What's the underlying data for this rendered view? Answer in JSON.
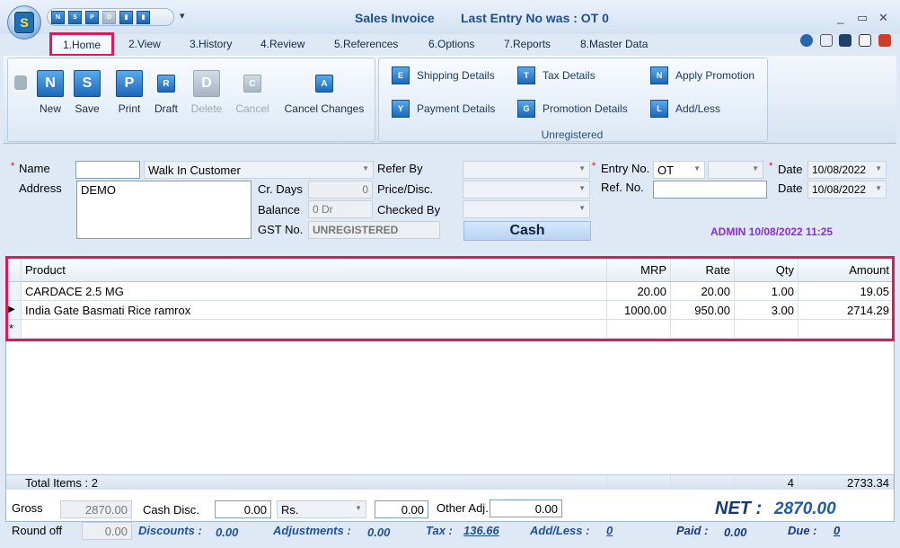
{
  "window": {
    "title": "Sales Invoice",
    "last_entry": "Last Entry No was : OT 0",
    "minimize": "_",
    "restore": "▭",
    "close": "✕",
    "qat_more": "▾",
    "orb_logo": "S"
  },
  "qat": [
    {
      "label": "N"
    },
    {
      "label": "S"
    },
    {
      "label": "P"
    },
    {
      "label": "D"
    },
    {
      "label": "▮"
    },
    {
      "label": "▮"
    }
  ],
  "tabs": [
    "1.Home",
    "2.View",
    "3.History",
    "4.Review",
    "5.References",
    "6.Options",
    "7.Reports",
    "8.Master Data"
  ],
  "ribbon": {
    "main_buttons": [
      {
        "label": "New",
        "icon": "N"
      },
      {
        "label": "Save",
        "icon": "S"
      },
      {
        "label": "Print",
        "icon": "P"
      },
      {
        "label": "Draft",
        "icon": "R"
      },
      {
        "label": "Delete",
        "icon": "D"
      },
      {
        "label": "Cancel",
        "icon": "C"
      },
      {
        "label": "Cancel Changes",
        "icon": "A"
      }
    ],
    "side_buttons": [
      {
        "label": "Shipping Details",
        "icon": "E"
      },
      {
        "label": "Tax Details",
        "icon": "T"
      },
      {
        "label": "Apply Promotion",
        "icon": "N"
      },
      {
        "label": "Payment Details",
        "icon": "Y"
      },
      {
        "label": "Promotion Details",
        "icon": "G"
      },
      {
        "label": "Add/Less",
        "icon": "L"
      }
    ],
    "group_caption": "Unregistered"
  },
  "form": {
    "name_label": "Name",
    "name_code": "",
    "name_value": "Walk In Customer",
    "address_label": "Address",
    "address_value": "DEMO",
    "cr_days_label": "Cr. Days",
    "cr_days_value": "0",
    "balance_label": "Balance",
    "balance_value": "0 Dr",
    "gst_label": "GST No.",
    "gst_value": "UNREGISTERED",
    "refer_by_label": "Refer By",
    "price_disc_label": "Price/Disc.",
    "checked_by_label": "Checked By",
    "payment_mode": "Cash",
    "entry_no_label": "Entry No.",
    "entry_no_series": "OT",
    "ref_no_label": "Ref. No.",
    "date_label": "Date",
    "date_value": "10/08/2022",
    "date2_label": "Date",
    "date2_value": "10/08/2022",
    "user_stamp": "ADMIN 10/08/2022 11:25"
  },
  "grid": {
    "columns": [
      "Product",
      "MRP",
      "Rate",
      "Qty",
      "Amount"
    ],
    "rows": [
      {
        "product": "CARDACE 2.5 MG",
        "mrp": "20.00",
        "rate": "20.00",
        "qty": "1.00",
        "amount": "19.05"
      },
      {
        "product": "India Gate Basmati Rice ramrox",
        "mrp": "1000.00",
        "rate": "950.00",
        "qty": "3.00",
        "amount": "2714.29"
      }
    ],
    "total_items": "Total Items : 2",
    "total_qty": "4",
    "total_amount": "2733.34"
  },
  "footer": {
    "gross_label": "Gross",
    "gross_value": "2870.00",
    "cash_disc_label": "Cash Disc.",
    "cash_disc_value": "0.00",
    "cash_disc_unit": "Rs.",
    "cash_disc_amount": "0.00",
    "other_adj_label": "Other Adj.",
    "other_adj_value": "0.00",
    "round_off_label": "Round off",
    "round_off_value": "0.00",
    "discounts_label": "Discounts :",
    "discounts_value": "0.00",
    "adjustments_label": "Adjustments :",
    "adjustments_value": "0.00",
    "tax_label": "Tax :",
    "tax_value": "136.66",
    "add_less_label": "Add/Less :",
    "add_less_value": "0",
    "net_label": "NET :",
    "net_value": "2870.00",
    "paid_label": "Paid :",
    "paid_value": "0.00",
    "due_label": "Due :",
    "due_value": "0"
  }
}
